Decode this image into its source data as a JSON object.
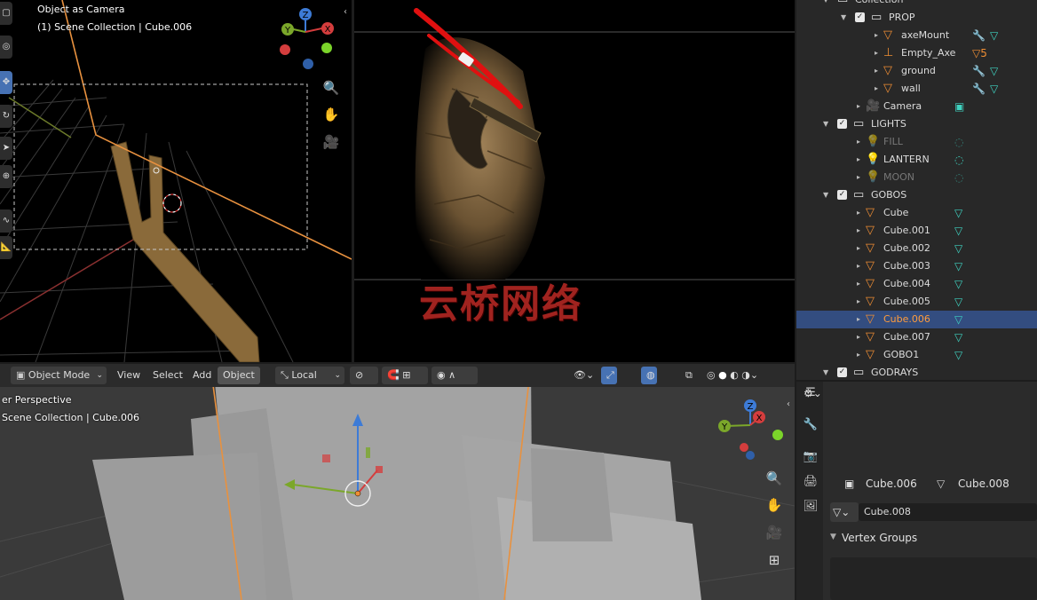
{
  "viewport_top_left": {
    "title_line1": "Object as Camera",
    "title_line2": "(1) Scene Collection | Cube.006",
    "gizmo": {
      "z": "Z",
      "y": "Y",
      "x": "X"
    }
  },
  "viewport_bottom": {
    "header": {
      "mode": "Object Mode",
      "menus": [
        "View",
        "Select",
        "Add",
        "Object"
      ],
      "transform_orientation": "Local"
    },
    "title_line1": "er Perspective",
    "title_line2": "Scene Collection | Cube.006",
    "gizmo": {
      "z": "Z",
      "y": "Y",
      "x": "X"
    }
  },
  "outliner": {
    "rows": [
      {
        "label": "Collection",
        "type": "collection",
        "indent": 1
      },
      {
        "label": "PROP",
        "type": "collection",
        "indent": 2,
        "checked": true
      },
      {
        "label": "axeMount",
        "type": "mesh",
        "indent": 3,
        "aux": "wrench",
        "aux2": "mesh"
      },
      {
        "label": "Empty_Axe",
        "type": "empty",
        "indent": 3,
        "aux": "mesh-count",
        "aux_text": "5"
      },
      {
        "label": "ground",
        "type": "mesh",
        "indent": 3,
        "aux": "wrench",
        "aux2": "mesh"
      },
      {
        "label": "wall",
        "type": "mesh",
        "indent": 3,
        "aux": "wrench",
        "aux2": "mesh"
      },
      {
        "label": "Camera",
        "type": "camera",
        "indent": 2
      },
      {
        "label": "LIGHTS",
        "type": "collection",
        "indent": 1,
        "checked": true
      },
      {
        "label": "FILL",
        "type": "light",
        "indent": 2,
        "dim": true
      },
      {
        "label": "LANTERN",
        "type": "light",
        "indent": 2
      },
      {
        "label": "MOON",
        "type": "light",
        "indent": 2,
        "dim": true
      },
      {
        "label": "GOBOS",
        "type": "collection",
        "indent": 1,
        "checked": true
      },
      {
        "label": "Cube",
        "type": "mesh",
        "indent": 2
      },
      {
        "label": "Cube.001",
        "type": "mesh",
        "indent": 2
      },
      {
        "label": "Cube.002",
        "type": "mesh",
        "indent": 2
      },
      {
        "label": "Cube.003",
        "type": "mesh",
        "indent": 2
      },
      {
        "label": "Cube.004",
        "type": "mesh",
        "indent": 2
      },
      {
        "label": "Cube.005",
        "type": "mesh",
        "indent": 2
      },
      {
        "label": "Cube.006",
        "type": "mesh",
        "indent": 2,
        "selected": true
      },
      {
        "label": "Cube.007",
        "type": "mesh",
        "indent": 2
      },
      {
        "label": "GOBO1",
        "type": "mesh",
        "indent": 2
      },
      {
        "label": "GODRAYS",
        "type": "collection",
        "indent": 1,
        "checked": true
      }
    ]
  },
  "properties": {
    "object_name": "Cube.006",
    "mesh_name": "Cube.008",
    "data_field": "Cube.008",
    "section": "Vertex Groups"
  },
  "watermark": "云桥网络",
  "colors": {
    "selection": "#334d80",
    "accent_blue": "#4772b3",
    "object_orange": "#ef8e34",
    "mesh_teal": "#3fd2c0",
    "annotation_red": "#e01010"
  }
}
